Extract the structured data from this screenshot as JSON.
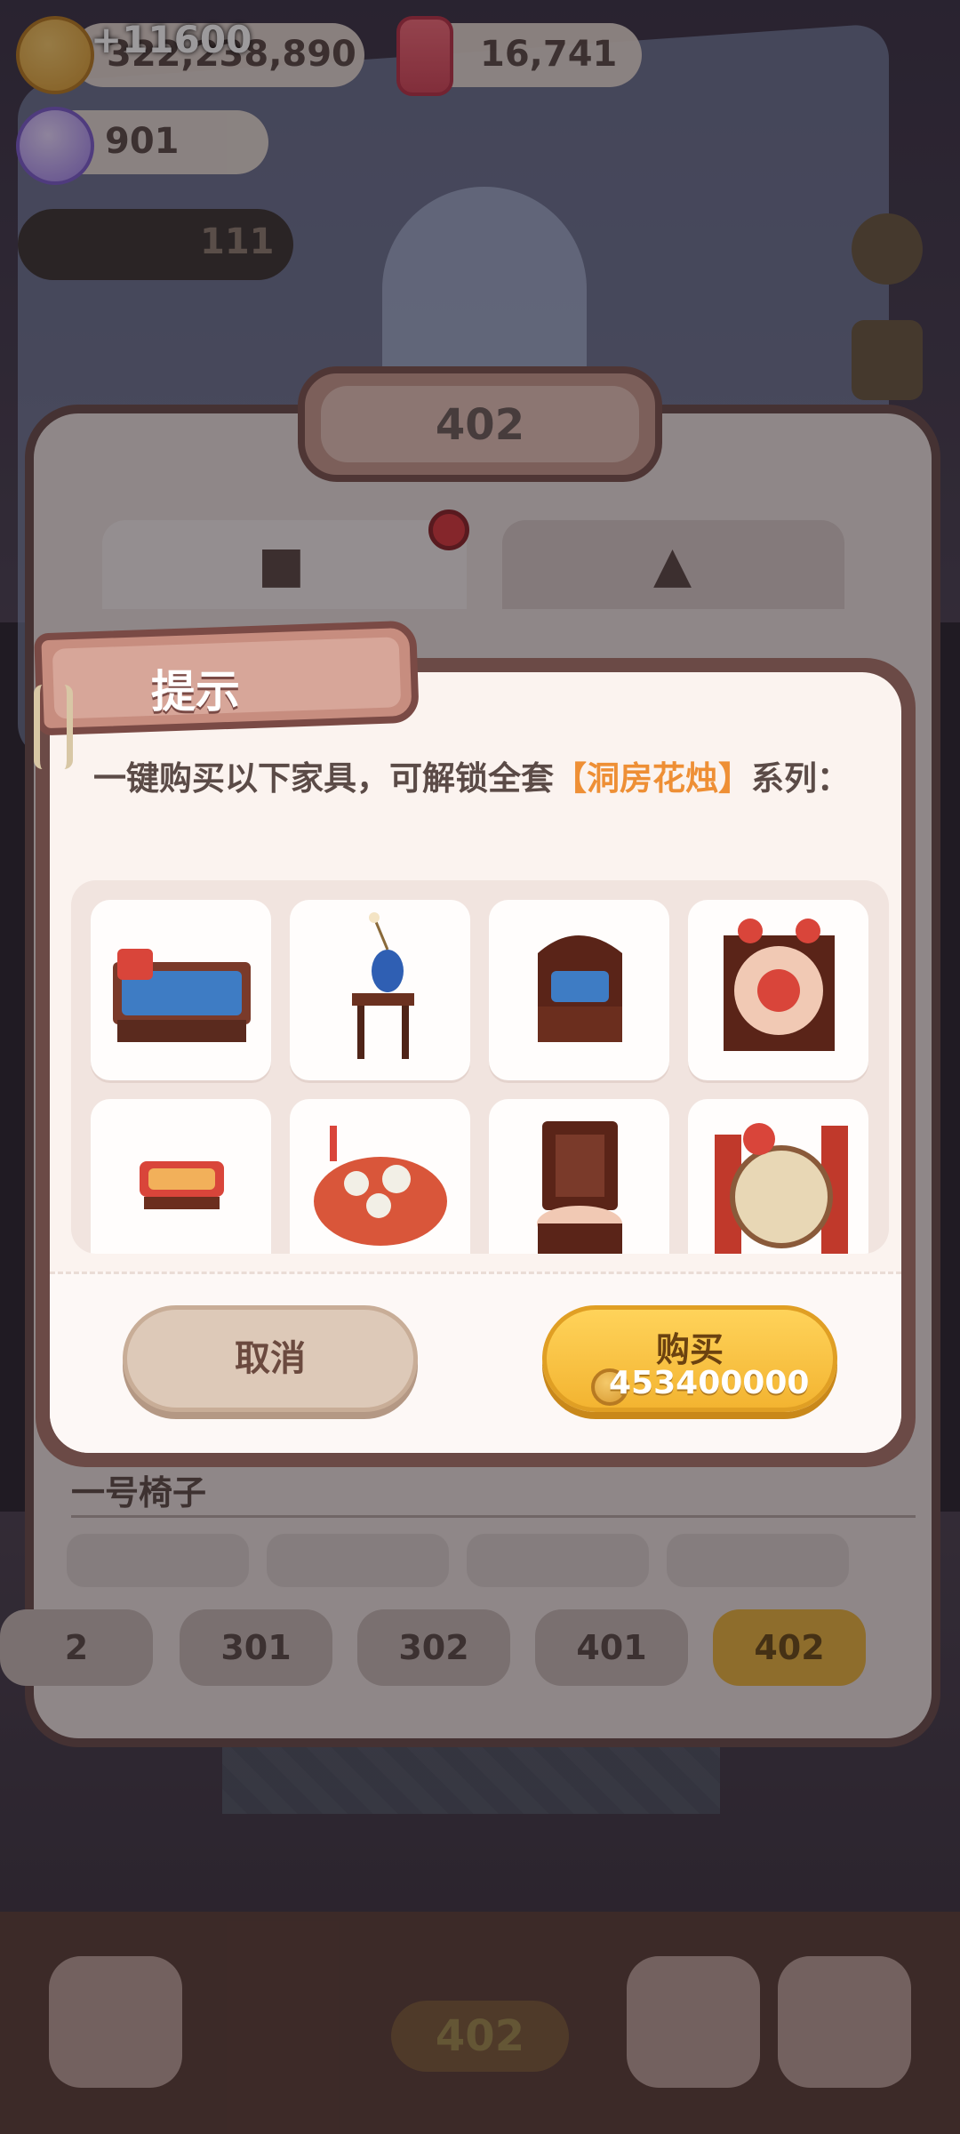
{
  "hud": {
    "coins_value": "322,238,890",
    "coins_gain": "+11600",
    "candle_value": "16,741",
    "candy_value": "901",
    "progress_value": "111"
  },
  "room": {
    "title": "402",
    "section_label": "一号椅子",
    "room_buttons": [
      "2",
      "301",
      "302",
      "401",
      "402"
    ],
    "active_room": "402"
  },
  "bottom": {
    "badge": "402"
  },
  "dialog": {
    "tag_title": "提示",
    "message_prefix": "一键购买以下家具，可解锁全套",
    "message_highlight": "【洞房花烛】",
    "message_suffix": "系列：",
    "items": [
      {
        "icon": "bed-icon"
      },
      {
        "icon": "vase-table-icon"
      },
      {
        "icon": "armchair-icon"
      },
      {
        "icon": "screen-icon"
      },
      {
        "icon": "footstool-icon"
      },
      {
        "icon": "banquet-table-icon"
      },
      {
        "icon": "carved-chair-icon"
      },
      {
        "icon": "drum-screen-icon"
      }
    ],
    "cancel_label": "取消",
    "buy_label": "购买",
    "buy_price": "453400000"
  },
  "colors": {
    "accent": "#EE8F35",
    "buy_button": "#F3B431",
    "panel": "#FBF3EF"
  }
}
